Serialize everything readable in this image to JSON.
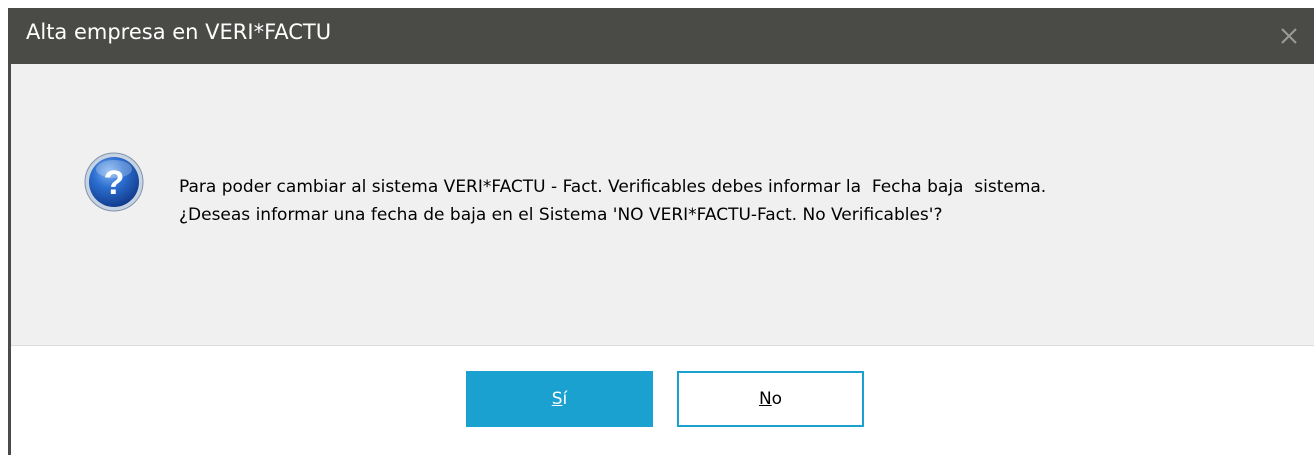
{
  "window": {
    "title": "Alta empresa en VERI*FACTU",
    "close_glyph": "×"
  },
  "dialog": {
    "icon": "question-icon",
    "message_line1": "Para poder cambiar al sistema VERI*FACTU - Fact. Verificables debes informar la  Fecha baja  sistema.",
    "message_line2": "¿Deseas informar una fecha de baja en el Sistema 'NO VERI*FACTU-Fact. No Verificables'?"
  },
  "buttons": {
    "yes": {
      "mnemonic": "S",
      "rest": "í"
    },
    "no": {
      "mnemonic": "N",
      "rest": "o"
    }
  },
  "colors": {
    "titlebar": "#4a4a46",
    "accent": "#1ba1d0",
    "content_bg": "#f0f0f0",
    "footer_bg": "#ffffff"
  }
}
